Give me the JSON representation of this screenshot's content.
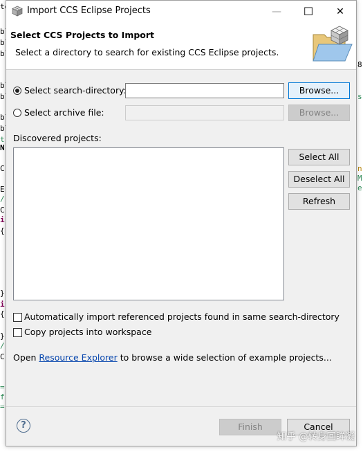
{
  "background": {
    "left_gutter": [
      "te",
      "bl",
      "bl",
      "bl",
      "bl",
      "bl",
      "bl",
      "bl",
      "t",
      "N",
      "C",
      "E",
      "/",
      "C",
      "i",
      "{",
      "}",
      "i",
      "{",
      "}",
      "/",
      "C",
      "=",
      "f",
      "="
    ],
    "right_gutter": [
      "8",
      "s",
      "n",
      "M",
      "e"
    ]
  },
  "window": {
    "title": "Import CCS Eclipse Projects",
    "minimize_glyph": "—",
    "maximize_glyph": "☐",
    "close_glyph": "✕"
  },
  "header": {
    "title": "Select CCS Projects to Import",
    "description": "Select a directory to search for existing CCS Eclipse projects."
  },
  "source": {
    "search_dir_label": "Select search-directory:",
    "search_dir_value": "",
    "search_dir_selected": true,
    "archive_label": "Select archive file:",
    "archive_value": "",
    "browse_label": "Browse...",
    "browse_disabled_label": "Browse..."
  },
  "projects": {
    "label": "Discovered projects:",
    "items": [],
    "select_all": "Select All",
    "deselect_all": "Deselect All",
    "refresh": "Refresh"
  },
  "options": {
    "auto_import": "Automatically import referenced projects found in same search-directory",
    "copy_projects": "Copy projects into workspace"
  },
  "explorer": {
    "prefix": "Open",
    "link": "Resource Explorer",
    "suffix": "to browse a wide selection of example projects..."
  },
  "footer": {
    "help_glyph": "?",
    "finish": "Finish",
    "cancel": "Cancel"
  },
  "watermark": "知乎 @转身回眸凝",
  "colors": {
    "accent": "#0078d7",
    "link": "#0645ad",
    "dialog_bg": "#f0f0f0"
  }
}
